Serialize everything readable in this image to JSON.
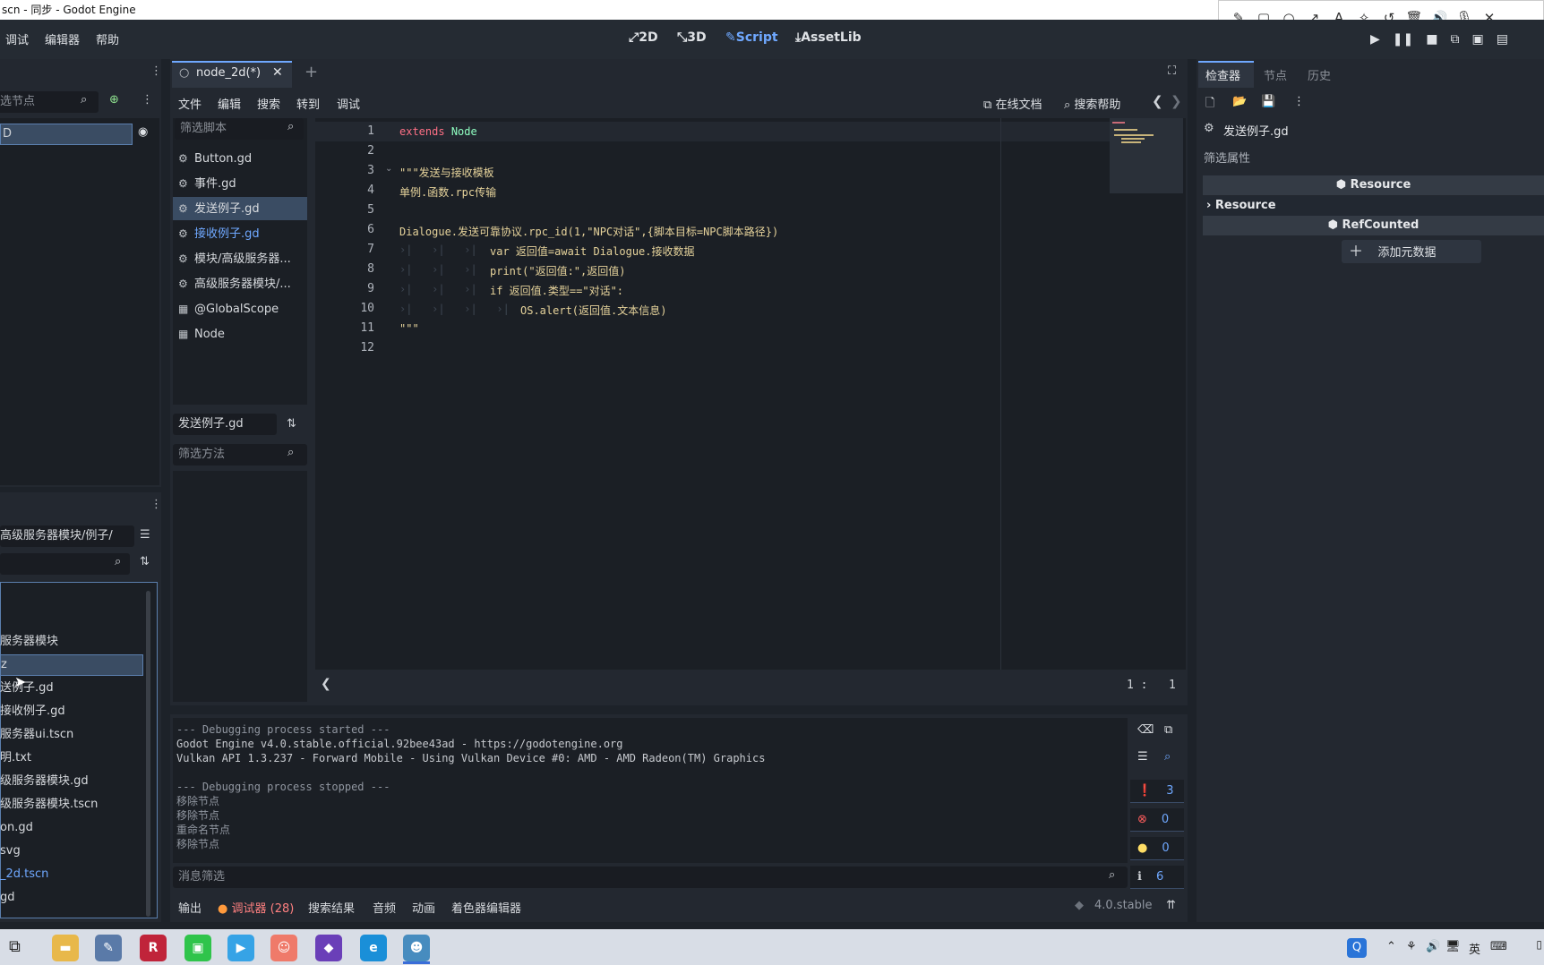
{
  "window": {
    "title": "scn - 同步 - Godot Engine"
  },
  "menus": [
    "调试",
    "编辑器",
    "帮助"
  ],
  "workspaces": [
    {
      "label": "2D",
      "icon": "⤢"
    },
    {
      "label": "3D",
      "icon": "⤡"
    },
    {
      "label": "Script",
      "icon": "✎"
    },
    {
      "label": "AssetLib",
      "icon": "⤓"
    }
  ],
  "scene_dock": {
    "filter_placeholder": "选节点",
    "selected_node": "D"
  },
  "fs_dock": {
    "path": "高级服务器模块/例子/",
    "items": [
      "服务器模块",
      "z",
      "送例子.gd",
      "接收例子.gd",
      "服务器ui.tscn",
      "明.txt",
      "级服务器模块.gd",
      "级服务器模块.tscn",
      "on.gd",
      "svg",
      "_2d.tscn",
      "gd"
    ]
  },
  "script_tab": {
    "name": "node_2d(*)"
  },
  "script_menus": [
    "文件",
    "编辑",
    "搜索",
    "转到",
    "调试"
  ],
  "script_links": {
    "online_docs": "在线文档",
    "search_help": "搜索帮助"
  },
  "script_list": {
    "filter_placeholder": "筛选脚本",
    "items": [
      {
        "label": "Button.gd",
        "icon": "⚙"
      },
      {
        "label": "事件.gd",
        "icon": "⚙"
      },
      {
        "label": "发送例子.gd",
        "icon": "⚙"
      },
      {
        "label": "接收例子.gd",
        "icon": "⚙"
      },
      {
        "label": "模块/高级服务器...",
        "icon": "⚙"
      },
      {
        "label": "高级服务器模块/...",
        "icon": "⚙"
      },
      {
        "label": "@GlobalScope",
        "icon": "▦"
      },
      {
        "label": "Node",
        "icon": "▦"
      }
    ]
  },
  "method_list": {
    "current_script": "发送例子.gd",
    "filter_placeholder": "筛选方法"
  },
  "code": {
    "line_numbers": [
      "1",
      "2",
      "3",
      "4",
      "5",
      "6",
      "7",
      "8",
      "9",
      "10",
      "11",
      "12"
    ],
    "l1_kw": "extends",
    "l1_type": "Node",
    "l3": "\"\"\"发送与接收模板",
    "l4": "单例.函数.rpc传输",
    "l6": "Dialogue.发送可靠协议.rpc_id(1,\"NPC对话\",{脚本目标=NPC脚本路径})",
    "l7": "var 返回值=await Dialogue.接收数据",
    "l8": "print(\"返回值:\",返回值)",
    "l9": "if 返回值.类型==\"对话\":",
    "l10": "OS.alert(返回值.文本信息)",
    "l11": "\"\"\"",
    "cursor": "1 :   1"
  },
  "output": {
    "lines": [
      "--- Debugging process started ---",
      "Godot Engine v4.0.stable.official.92bee43ad - https://godotengine.org",
      "Vulkan API 1.3.237 - Forward Mobile - Using Vulkan Device #0: AMD - AMD Radeon(TM) Graphics",
      "",
      "--- Debugging process stopped ---",
      "移除节点",
      "移除节点",
      "重命名节点",
      "移除节点"
    ],
    "filter_placeholder": "消息筛选",
    "counts": {
      "messages": "3",
      "errors": "0",
      "warnings": "0",
      "info": "6"
    }
  },
  "bottom_tabs": [
    "输出",
    "调试器 (28)",
    "搜索结果",
    "音频",
    "动画",
    "着色器编辑器"
  ],
  "version": "4.0.stable",
  "inspector": {
    "tabs": [
      "检查器",
      "节点",
      "历史"
    ],
    "resource_name": "发送例子.gd",
    "filter_placeholder": "筛选属性",
    "class_resource": "Resource",
    "section_resource": "Resource",
    "class_refcounted": "RefCounted",
    "add_metadata": "添加元数据"
  },
  "colors": {
    "accent": "#6fa8ff",
    "error": "#ff5d5d",
    "warning": "#ffdd65"
  },
  "taskbar": {
    "input_method": "英"
  }
}
